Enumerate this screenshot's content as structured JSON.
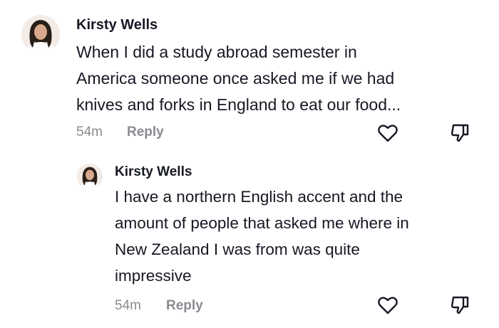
{
  "comments": [
    {
      "username": "Kirsty Wells",
      "text": "When I did a study abroad semester in\nAmerica someone once asked me if we had\nknives and forks in England to eat our food...",
      "time": "54m",
      "reply_label": "Reply",
      "like_icon": "heart-outline-icon",
      "dislike_icon": "thumbs-down-icon"
    },
    {
      "username": "Kirsty Wells",
      "text": "I have a northern English accent and the\namount of people that asked me where in\nNew Zealand I was from was quite\nimpressive",
      "time": "54m",
      "reply_label": "Reply",
      "like_icon": "heart-outline-icon",
      "dislike_icon": "thumbs-down-icon"
    }
  ],
  "colors": {
    "text_primary": "#161823",
    "text_secondary": "#8a8b91",
    "background": "#ffffff"
  }
}
